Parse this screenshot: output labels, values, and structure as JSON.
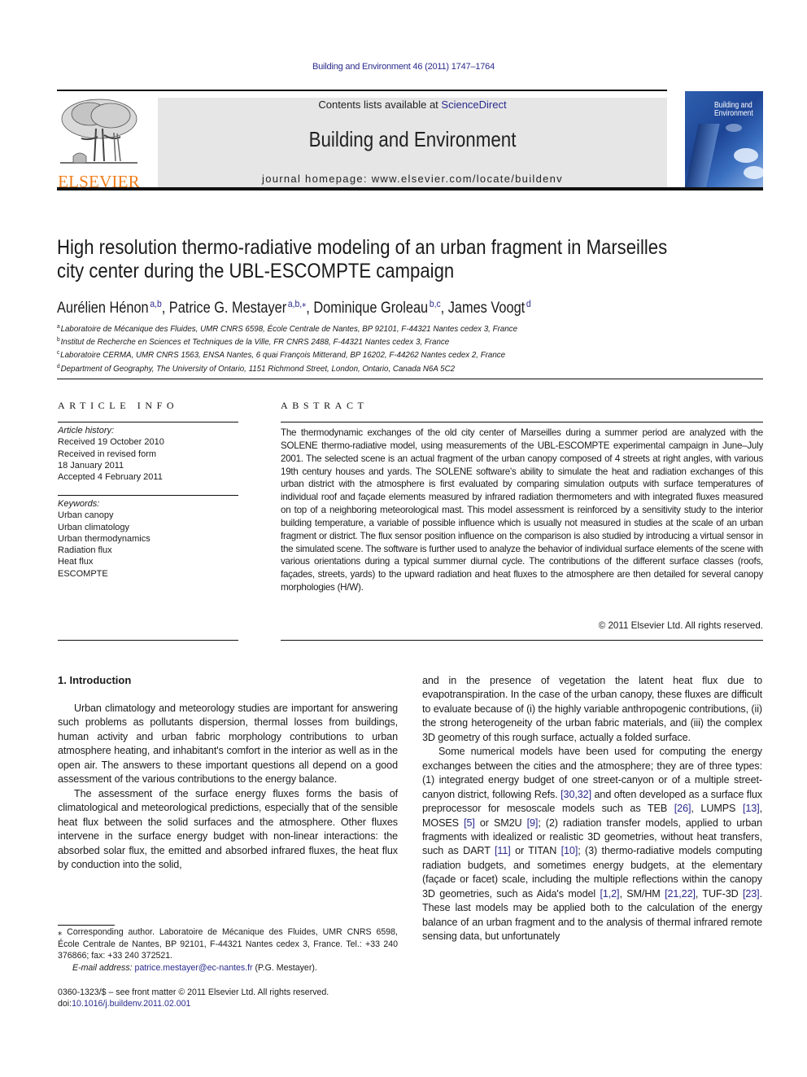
{
  "header": {
    "citation": "Building and Environment 46 (2011) 1747–1764",
    "contents_prefix": "Contents lists available at ",
    "contents_link": "ScienceDirect",
    "journal_title": "Building and Environment",
    "homepage": "journal homepage: www.elsevier.com/locate/buildenv",
    "publisher_logo_text": "ELSEVIER",
    "cover_title_line1": "Building and",
    "cover_title_line2": "Environment",
    "colors": {
      "link": "#2a2a8c",
      "elsevier_orange": "#f07e1a",
      "banner_bg": "#e6e6e6"
    }
  },
  "article": {
    "title_line1": "High resolution thermo-radiative modeling of an urban fragment in Marseilles",
    "title_line2": "city center during the UBL-ESCOMPTE campaign",
    "authors": [
      {
        "name": "Aurélien Hénon",
        "sup": "a,b",
        "sep": ", "
      },
      {
        "name": "Patrice G. Mestayer",
        "sup": "a,b,⁎",
        "sep": ", "
      },
      {
        "name": "Dominique Groleau",
        "sup": "b,c",
        "sep": ", "
      },
      {
        "name": "James Voogt",
        "sup": "d",
        "sep": ""
      }
    ],
    "affiliations": [
      {
        "mark": "a",
        "text": "Laboratoire de Mécanique des Fluides, UMR CNRS 6598, École Centrale de Nantes, BP 92101, F-44321 Nantes cedex 3, France"
      },
      {
        "mark": "b",
        "text": "Institut de Recherche en Sciences et Techniques de la Ville, FR CNRS 2488, F-44321 Nantes cedex 3, France"
      },
      {
        "mark": "c",
        "text": "Laboratoire CERMA, UMR CNRS 1563, ENSA Nantes, 6 quai François Mitterand, BP 16202, F-44262 Nantes cedex 2, France"
      },
      {
        "mark": "d",
        "text": "Department of Geography, The University of Ontario, 1151 Richmond Street, London, Ontario, Canada N6A 5C2"
      }
    ]
  },
  "article_info": {
    "heading": "ARTICLE INFO",
    "history_label": "Article history:",
    "history": [
      "Received 19 October 2010",
      "Received in revised form",
      "18 January 2011",
      "Accepted 4 February 2011"
    ],
    "keywords_label": "Keywords:",
    "keywords": [
      "Urban canopy",
      "Urban climatology",
      "Urban thermodynamics",
      "Radiation flux",
      "Heat flux",
      "ESCOMPTE"
    ]
  },
  "abstract": {
    "heading": "ABSTRACT",
    "text": "The thermodynamic exchanges of the old city center of Marseilles during a summer period are analyzed with the SOLENE thermo-radiative model, using measurements of the UBL-ESCOMPTE experimental campaign in June–July 2001. The selected scene is an actual fragment of the urban canopy composed of 4 streets at right angles, with various 19th century houses and yards. The SOLENE software's ability to simulate the heat and radiation exchanges of this urban district with the atmosphere is first evaluated by comparing simulation outputs with surface temperatures of individual roof and façade elements measured by infrared radiation thermometers and with integrated fluxes measured on top of a neigh­boring meteorological mast. This model assessment is reinforced by a sensitivity study to the interior building temperature, a variable of possible influence which is usually not measured in studies at the scale of an urban fragment or district. The flux sensor position influence on the comparison is also studied by introducing a virtual sensor in the simulated scene. The software is further used to analyze the behavior of individual surface elements of the scene with various orientations during a typical summer diurnal cycle. The contributions of the different surface classes (roofs, façades, streets, yards) to the upward radiation and heat fluxes to the atmosphere are then detailed for several canopy morphologies (H/W).",
    "copyright": "© 2011 Elsevier Ltd. All rights reserved."
  },
  "body": {
    "section_heading": "1.  Introduction",
    "left_paragraphs": [
      "Urban climatology and meteorology studies are important for answering such problems as pollutants dispersion, thermal losses from buildings, human activity and urban fabric morphology contributions to urban atmosphere heating, and inhabitant's comfort in the interior as well as in the open air. The answers to these important questions all depend on a good assessment of the various contributions to the energy balance.",
      "The assessment of the surface energy fluxes forms the basis of climatological and meteorological predictions, especially that of the sensible heat flux between the solid surfaces and the atmosphere. Other fluxes intervene in the surface energy budget with non-linear interactions: the absorbed solar flux, the emitted and absorbed infrared fluxes, the heat flux by conduction into the solid,"
    ],
    "right_p1": "and in the presence of vegetation the latent heat flux due to evapotranspiration. In the case of the urban canopy, these fluxes are difficult to evaluate because of (i) the highly variable anthropogenic contributions, (ii) the strong heterogeneity of the urban fabric materials, and (iii) the complex 3D geometry of this rough surface, actually a folded surface.",
    "right_p2": {
      "t1": "Some numerical models have been used for computing the energy exchanges between the cities and the atmosphere; they are of three types: (1) integrated energy budget of one street-canyon or of a multiple street-canyon district, following Refs. ",
      "r1": "[30,32]",
      "t2": " and often developed as a surface flux preprocessor for mesoscale models such as TEB ",
      "r2": "[26]",
      "t3": ", LUMPS ",
      "r3": "[13]",
      "t4": ", MOSES ",
      "r4": "[5]",
      "t5": " or SM2U ",
      "r5": "[9]",
      "t6": "; (2) radiation transfer models, applied to urban fragments with idealized or realistic 3D geometries, without heat transfers, such as DART ",
      "r6": "[11]",
      "t7": " or TITAN ",
      "r7": "[10]",
      "t8": "; (3) thermo-radiative models computing radiation budgets, and sometimes energy budgets, at the elemen­tary (façade or facet) scale, including the multiple reflections within the canopy 3D geometries, such as Aida's model ",
      "r8": "[1,2]",
      "t9": ", SM/HM ",
      "r9": "[21,22]",
      "t10": ", TUF-3D ",
      "r10": "[23]",
      "t11": ". These last models may be applied both to the calculation of the energy balance of an urban fragment and to the analysis of thermal infrared remote sensing data, but unfortunately"
    }
  },
  "footnote": {
    "corresponding": "⁎  Corresponding author. Laboratoire de Mécanique des Fluides, UMR CNRS 6598, École Centrale de Nantes, BP 92101, F-44321 Nantes cedex 3, France. Tel.: +33 240 376866; fax: +33 240 372521.",
    "email_label": "E-mail address: ",
    "email": "patrice.mestayer@ec-nantes.fr",
    "email_suffix": " (P.G. Mestayer).",
    "front_matter": "0360-1323/$ – see front matter © 2011 Elsevier Ltd. All rights reserved.",
    "doi_label": "doi:",
    "doi": "10.1016/j.buildenv.2011.02.001"
  }
}
